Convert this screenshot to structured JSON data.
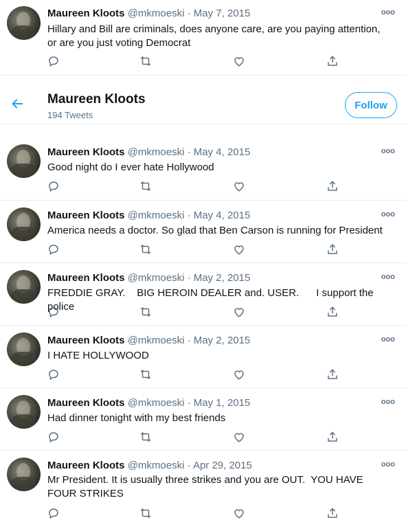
{
  "header": {
    "title": "Maureen Kloots",
    "tweet_count": "194 Tweets",
    "follow_label": "Follow",
    "back_icon": "arrow-left-icon"
  },
  "colors": {
    "accent": "#1da1f2",
    "secondary_text": "#5b7083",
    "divider": "#e6ecf0"
  },
  "tweets": [
    {
      "name": "Maureen Kloots",
      "handle": "@mkmoeski",
      "dot": "·",
      "date": "May 7, 2015",
      "text": "Hillary and Bill are criminals, does anyone care, are you paying attention,  or are you just voting Democrat"
    },
    {
      "name": "Maureen Kloots",
      "handle": "@mkmoeski",
      "dot": "·",
      "date": "May 4, 2015",
      "text": "Good night do I ever hate Hollywood"
    },
    {
      "name": "Maureen Kloots",
      "handle": "@mkmoeski",
      "dot": "·",
      "date": "May 4, 2015",
      "text": "America needs a doctor. So glad that Ben Carson is running for President"
    },
    {
      "name": "Maureen Kloots",
      "handle": "@mkmoeski",
      "dot": "·",
      "date": "May 2, 2015",
      "text": "FREDDIE GRAY.    BIG HEROIN DEALER and. USER.      I support the police"
    },
    {
      "name": "Maureen Kloots",
      "handle": "@mkmoeski",
      "dot": "·",
      "date": "May 2, 2015",
      "text": "I HATE HOLLYWOOD"
    },
    {
      "name": "Maureen Kloots",
      "handle": "@mkmoeski",
      "dot": "·",
      "date": "May 1, 2015",
      "text": "Had dinner tonight with my best friends"
    },
    {
      "name": "Maureen Kloots",
      "handle": "@mkmoeski",
      "dot": "·",
      "date": "Apr 29, 2015",
      "text": "Mr President. It is usually three strikes and you are OUT.  YOU HAVE FOUR STRIKES"
    }
  ],
  "more_glyph": "ooo",
  "action_icons": [
    "reply-icon",
    "retweet-icon",
    "like-icon",
    "share-icon"
  ]
}
